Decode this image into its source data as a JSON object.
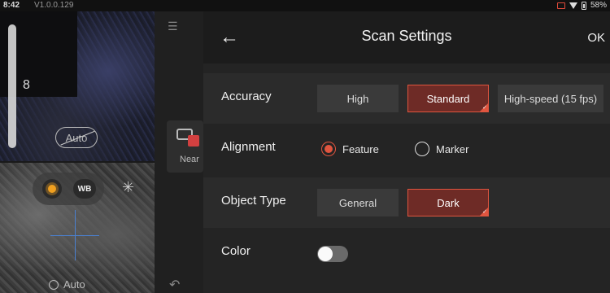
{
  "status_bar": {
    "time": "8:42",
    "version": "V1.0.0.129",
    "battery": "58%"
  },
  "preview": {
    "exposure_value": "8",
    "auto_label": "Auto",
    "wb_label": "WB",
    "bottom_auto_label": "Auto"
  },
  "camera_card": {
    "label": "Near"
  },
  "settings": {
    "title": "Scan Settings",
    "ok_label": "OK",
    "accuracy": {
      "label": "Accuracy",
      "options": [
        "High",
        "Standard",
        "High-speed (15 fps)"
      ],
      "selected": "Standard"
    },
    "alignment": {
      "label": "Alignment",
      "options": [
        "Feature",
        "Marker"
      ],
      "selected": "Feature"
    },
    "object_type": {
      "label": "Object Type",
      "options": [
        "General",
        "Dark"
      ],
      "selected": "Dark"
    },
    "color": {
      "label": "Color",
      "enabled": false
    }
  },
  "colors": {
    "accent": "#e0553f",
    "selected_bg": "#6e2b26"
  }
}
